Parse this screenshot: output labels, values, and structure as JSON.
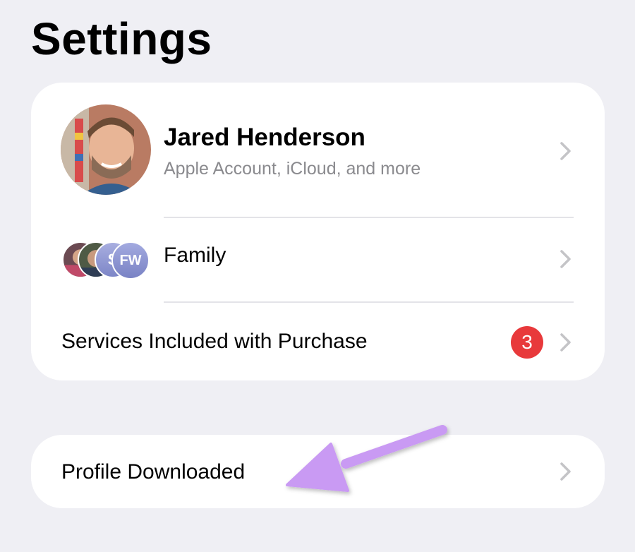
{
  "page": {
    "title": "Settings"
  },
  "account": {
    "name": "Jared Henderson",
    "subtitle": "Apple Account, iCloud, and more",
    "avatar_icon": "profile-photo"
  },
  "family": {
    "label": "Family",
    "avatars": [
      {
        "type": "photo",
        "initials": ""
      },
      {
        "type": "photo",
        "initials": ""
      },
      {
        "type": "initials",
        "initials": "S"
      },
      {
        "type": "initials",
        "initials": "FW"
      }
    ]
  },
  "services": {
    "label": "Services Included with Purchase",
    "badge_count": "3"
  },
  "profile": {
    "label": "Profile Downloaded"
  },
  "annotation": {
    "arrow_color": "#c99af3",
    "arrow_icon": "arrow-pointing-left"
  },
  "colors": {
    "background": "#efeff4",
    "card": "#ffffff",
    "badge": "#e8393b",
    "secondary_text": "#8a8a8e",
    "chevron": "#c4c4c7"
  }
}
